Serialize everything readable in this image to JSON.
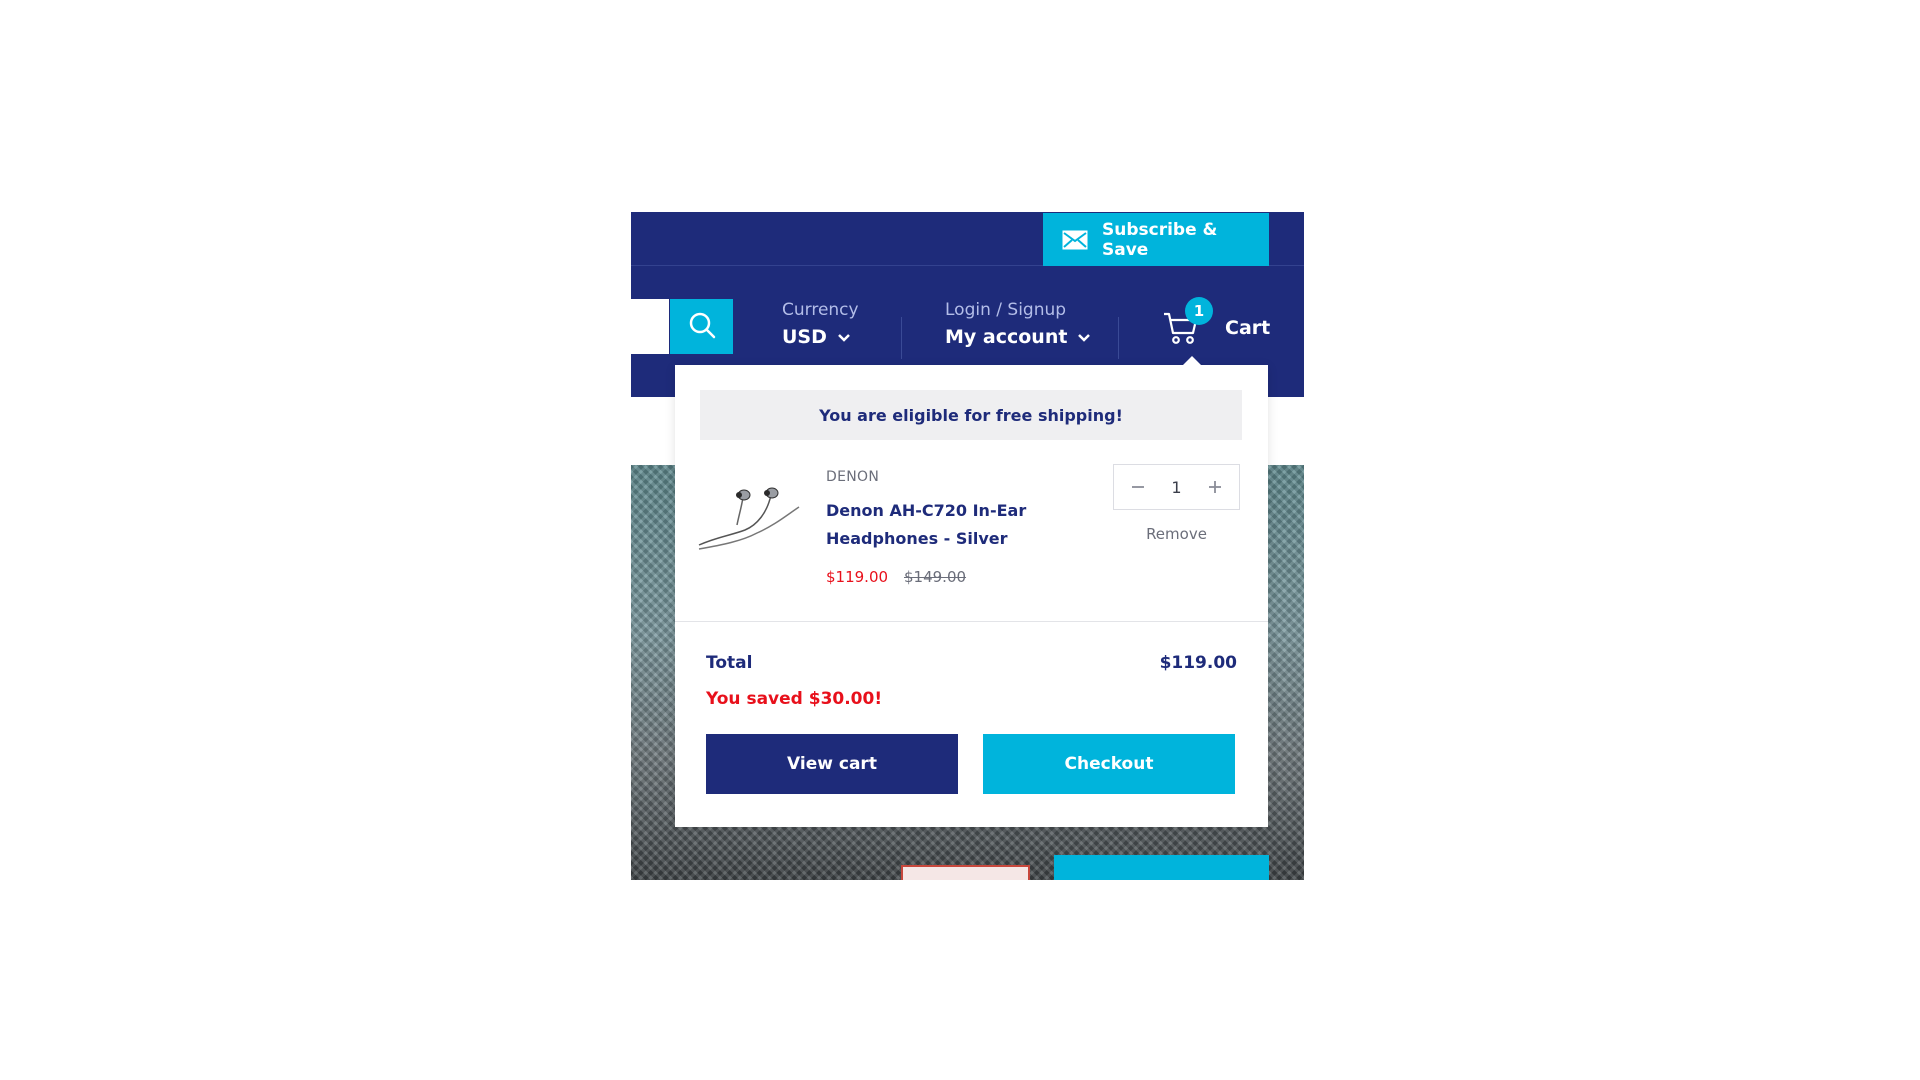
{
  "topbar": {
    "subscribe_label": "Subscribe & Save",
    "subscribe_icon": "envelope-icon"
  },
  "header": {
    "search_icon": "search-icon",
    "currency_label": "Currency",
    "currency_value": "USD",
    "account_label": "Login / Signup",
    "account_value": "My account",
    "cart_label": "Cart",
    "cart_count": "1",
    "cart_icon": "cart-icon"
  },
  "cart_dropdown": {
    "shipping_message": "You are eligible for free shipping!",
    "items": [
      {
        "vendor": "DENON",
        "title": "Denon AH-C720 In-Ear Headphones - Silver",
        "sale_price": "$119.00",
        "compare_price": "$149.00",
        "quantity": "1",
        "remove_label": "Remove"
      }
    ],
    "total_label": "Total",
    "total_value": "$119.00",
    "savings_message": "You saved $30.00!",
    "view_cart_label": "View cart",
    "checkout_label": "Checkout"
  },
  "colors": {
    "navy": "#1e2b7a",
    "accent": "#00b4dc",
    "sale_red": "#e8101b"
  }
}
